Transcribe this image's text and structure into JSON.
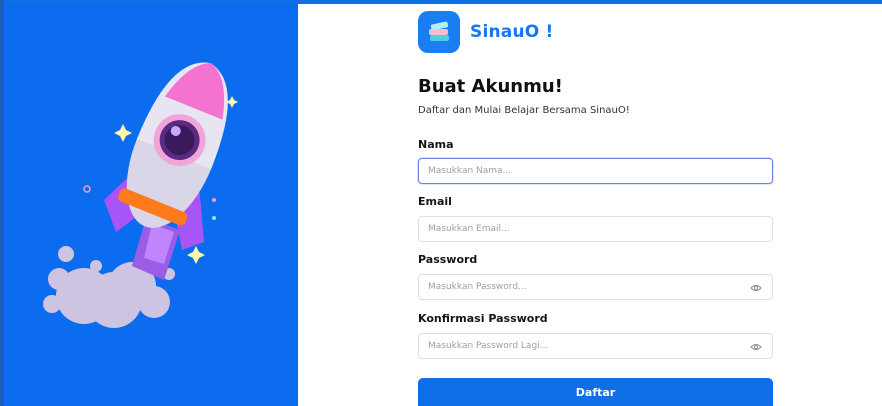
{
  "brand": {
    "name": "SinauO !",
    "logo_icon": "books-icon",
    "color": "#1676ef"
  },
  "form": {
    "title": "Buat Akunmu!",
    "subtitle": "Daftar dan Mulai Belajar Bersama SinauO!",
    "fields": [
      {
        "label": "Nama",
        "placeholder": "Masukkan Nama...",
        "value": "",
        "type": "text",
        "focused": true
      },
      {
        "label": "Email",
        "placeholder": "Masukkan Email...",
        "value": "",
        "type": "email"
      },
      {
        "label": "Password",
        "placeholder": "Masukkan Password...",
        "value": "",
        "type": "password",
        "icon": "eye-icon"
      },
      {
        "label": "Konfirmasi Password",
        "placeholder": "Masukkan Password Lagi...",
        "value": "",
        "type": "password",
        "icon": "eye-icon"
      }
    ],
    "submit_label": "Daftar"
  },
  "illustration": {
    "icon": "rocket-icon",
    "background_color": "#0b6cf0"
  },
  "colors": {
    "primary": "#0f6fe6",
    "focus_border": "#6e7fe0"
  }
}
